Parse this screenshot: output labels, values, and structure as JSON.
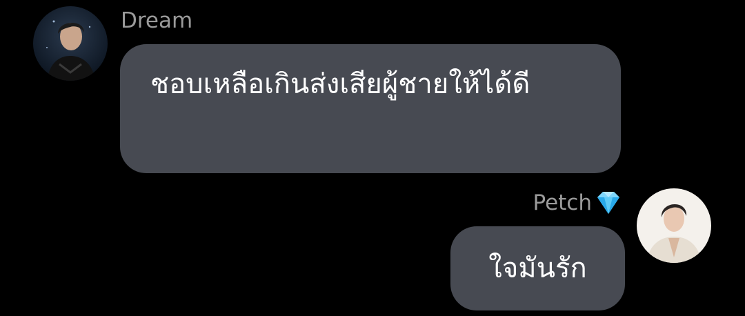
{
  "conversation": {
    "messages": [
      {
        "sender": "Dream",
        "text": "ชอบเหลือเกินส่งเสียผู้ชายให้ได้ดี",
        "avatar_icon": "profile-photo-dream"
      },
      {
        "sender": "Petch",
        "sender_badge_icon": "gem-icon",
        "text": "ใจมันรัก",
        "avatar_icon": "profile-photo-petch"
      }
    ]
  },
  "colors": {
    "background": "#000000",
    "bubble": "#474a52",
    "sender_name": "#9a9a9a",
    "message_text": "#ffffff",
    "badge": "#4fc3f7"
  }
}
